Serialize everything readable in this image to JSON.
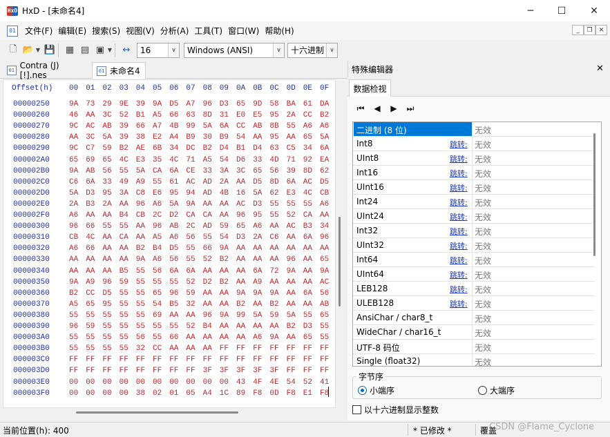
{
  "window": {
    "title": "HxD - [未命名4]",
    "logo": "HxD"
  },
  "menu": {
    "doc_icon": "01",
    "items": [
      "文件(F)",
      "编辑(E)",
      "搜索(S)",
      "视图(V)",
      "分析(A)",
      "工具(T)",
      "窗口(W)",
      "帮助(H)"
    ]
  },
  "toolbar": {
    "bytes_per_row": "16",
    "charset": "Windows (ANSI)",
    "offset_base": "十六进制"
  },
  "tabs": [
    {
      "label": "Contra (J) [!].nes",
      "active": false
    },
    {
      "label": "未命名4",
      "active": true
    }
  ],
  "hex": {
    "offset_label": "Offset(h)",
    "columns": [
      "00",
      "01",
      "02",
      "03",
      "04",
      "05",
      "06",
      "07",
      "08",
      "09",
      "0A",
      "0B",
      "0C",
      "0D",
      "0E",
      "0F"
    ],
    "rows": [
      {
        "addr": "00000250",
        "bytes": [
          "9A",
          "73",
          "29",
          "9E",
          "39",
          "9A",
          "D5",
          "A7",
          "96",
          "D3",
          "65",
          "9D",
          "58",
          "BA",
          "61",
          "DA"
        ]
      },
      {
        "addr": "00000260",
        "bytes": [
          "46",
          "AA",
          "3C",
          "52",
          "B1",
          "A5",
          "66",
          "63",
          "8D",
          "31",
          "E0",
          "E5",
          "95",
          "2A",
          "CC",
          "B2"
        ]
      },
      {
        "addr": "00000270",
        "bytes": [
          "9C",
          "AC",
          "AB",
          "39",
          "66",
          "A7",
          "4B",
          "99",
          "5A",
          "6A",
          "CC",
          "AB",
          "8B",
          "55",
          "A6",
          "A6"
        ]
      },
      {
        "addr": "00000280",
        "bytes": [
          "AA",
          "3C",
          "5A",
          "39",
          "38",
          "E2",
          "A4",
          "B9",
          "30",
          "B9",
          "54",
          "AA",
          "95",
          "AA",
          "65",
          "5A"
        ]
      },
      {
        "addr": "00000290",
        "bytes": [
          "9C",
          "C7",
          "59",
          "B2",
          "AE",
          "6B",
          "34",
          "DC",
          "B2",
          "D4",
          "B1",
          "D4",
          "63",
          "C5",
          "34",
          "6A"
        ]
      },
      {
        "addr": "000002A0",
        "bytes": [
          "65",
          "69",
          "65",
          "4C",
          "E3",
          "35",
          "4C",
          "71",
          "A5",
          "54",
          "D6",
          "33",
          "4D",
          "71",
          "92",
          "EA"
        ]
      },
      {
        "addr": "000002B0",
        "bytes": [
          "9A",
          "AB",
          "56",
          "55",
          "5A",
          "CA",
          "6A",
          "CE",
          "33",
          "3A",
          "3C",
          "65",
          "56",
          "39",
          "8D",
          "62"
        ]
      },
      {
        "addr": "000002C0",
        "bytes": [
          "C6",
          "6A",
          "33",
          "49",
          "A9",
          "55",
          "61",
          "AC",
          "AD",
          "2A",
          "AA",
          "D5",
          "8D",
          "6A",
          "AC",
          "D5"
        ]
      },
      {
        "addr": "000002D0",
        "bytes": [
          "5A",
          "D3",
          "95",
          "3A",
          "C8",
          "E6",
          "95",
          "94",
          "AD",
          "4B",
          "16",
          "5A",
          "62",
          "E3",
          "4C",
          "CB"
        ]
      },
      {
        "addr": "000002E0",
        "bytes": [
          "2A",
          "B3",
          "2A",
          "AA",
          "96",
          "A6",
          "5A",
          "9A",
          "AA",
          "AA",
          "AC",
          "D3",
          "55",
          "55",
          "55",
          "A6"
        ]
      },
      {
        "addr": "000002F0",
        "bytes": [
          "A6",
          "AA",
          "AA",
          "B4",
          "CB",
          "2C",
          "D2",
          "CA",
          "CA",
          "AA",
          "96",
          "95",
          "55",
          "52",
          "CA",
          "AA"
        ]
      },
      {
        "addr": "00000300",
        "bytes": [
          "96",
          "66",
          "55",
          "55",
          "AA",
          "96",
          "AB",
          "2C",
          "AD",
          "59",
          "65",
          "A6",
          "AA",
          "AC",
          "B3",
          "34"
        ]
      },
      {
        "addr": "00000310",
        "bytes": [
          "CB",
          "4C",
          "AA",
          "CA",
          "AA",
          "A5",
          "A6",
          "56",
          "55",
          "54",
          "D3",
          "2A",
          "C6",
          "AA",
          "6A",
          "96"
        ]
      },
      {
        "addr": "00000320",
        "bytes": [
          "A6",
          "66",
          "AA",
          "AA",
          "B2",
          "B4",
          "D5",
          "55",
          "66",
          "9A",
          "AA",
          "AA",
          "AA",
          "AA",
          "AA",
          "AA"
        ]
      },
      {
        "addr": "00000330",
        "bytes": [
          "AA",
          "AA",
          "AA",
          "AA",
          "9A",
          "A6",
          "56",
          "55",
          "52",
          "B2",
          "AA",
          "AA",
          "AA",
          "96",
          "AA",
          "65"
        ]
      },
      {
        "addr": "00000340",
        "bytes": [
          "AA",
          "AA",
          "AA",
          "B5",
          "55",
          "56",
          "6A",
          "6A",
          "AA",
          "AA",
          "AA",
          "6A",
          "72",
          "9A",
          "AA",
          "9A"
        ]
      },
      {
        "addr": "00000350",
        "bytes": [
          "9A",
          "A9",
          "96",
          "59",
          "55",
          "55",
          "55",
          "52",
          "D2",
          "B2",
          "AA",
          "A9",
          "AA",
          "AA",
          "AA",
          "AC"
        ]
      },
      {
        "addr": "00000360",
        "bytes": [
          "B2",
          "CC",
          "D5",
          "55",
          "55",
          "65",
          "96",
          "59",
          "AA",
          "AA",
          "9A",
          "9A",
          "9A",
          "AA",
          "6A",
          "56"
        ]
      },
      {
        "addr": "00000370",
        "bytes": [
          "A5",
          "65",
          "95",
          "55",
          "55",
          "54",
          "B5",
          "32",
          "AA",
          "AA",
          "B2",
          "AA",
          "B2",
          "AA",
          "AA",
          "AB"
        ]
      },
      {
        "addr": "00000380",
        "bytes": [
          "55",
          "55",
          "55",
          "55",
          "55",
          "69",
          "AA",
          "AA",
          "96",
          "9A",
          "99",
          "5A",
          "59",
          "5A",
          "55",
          "65"
        ]
      },
      {
        "addr": "00000390",
        "bytes": [
          "96",
          "59",
          "55",
          "55",
          "55",
          "55",
          "55",
          "52",
          "B4",
          "AA",
          "AA",
          "AA",
          "AA",
          "B2",
          "D3",
          "55"
        ]
      },
      {
        "addr": "000003A0",
        "bytes": [
          "55",
          "55",
          "55",
          "55",
          "56",
          "55",
          "66",
          "AA",
          "AA",
          "AA",
          "AA",
          "A6",
          "9A",
          "AA",
          "65",
          "55"
        ]
      },
      {
        "addr": "000003B0",
        "bytes": [
          "55",
          "55",
          "55",
          "55",
          "32",
          "CC",
          "AA",
          "AA",
          "AA",
          "FF",
          "FF",
          "FF",
          "FF",
          "FF",
          "FF",
          "FF"
        ]
      },
      {
        "addr": "000003C0",
        "bytes": [
          "FF",
          "FF",
          "FF",
          "FF",
          "FF",
          "FF",
          "FF",
          "FF",
          "FF",
          "FF",
          "FF",
          "FF",
          "FF",
          "FF",
          "FF",
          "FF"
        ]
      },
      {
        "addr": "000003D0",
        "bytes": [
          "FF",
          "FF",
          "FF",
          "FF",
          "FF",
          "FF",
          "FF",
          "FF",
          "3F",
          "3F",
          "3F",
          "3F",
          "3F",
          "FF",
          "FF",
          "FF"
        ]
      },
      {
        "addr": "000003E0",
        "bytes": [
          "00",
          "00",
          "00",
          "00",
          "00",
          "00",
          "00",
          "00",
          "00",
          "00",
          "43",
          "4F",
          "4E",
          "54",
          "52",
          "41"
        ]
      },
      {
        "addr": "000003F0",
        "bytes": [
          "00",
          "00",
          "00",
          "00",
          "38",
          "02",
          "01",
          "05",
          "A4",
          "1C",
          "89",
          "F8",
          "0D",
          "F8",
          "E1",
          "F8"
        ]
      }
    ]
  },
  "special_editor": {
    "title": "特殊编辑器",
    "tab": "数据检视",
    "rows": [
      {
        "name": "二进制 (8 位)",
        "link": "",
        "value": "无效",
        "selected": true
      },
      {
        "name": "Int8",
        "link": "跳转:",
        "value": "无效"
      },
      {
        "name": "UInt8",
        "link": "跳转:",
        "value": "无效"
      },
      {
        "name": "Int16",
        "link": "跳转:",
        "value": "无效"
      },
      {
        "name": "UInt16",
        "link": "跳转:",
        "value": "无效"
      },
      {
        "name": "Int24",
        "link": "跳转:",
        "value": "无效"
      },
      {
        "name": "UInt24",
        "link": "跳转:",
        "value": "无效"
      },
      {
        "name": "Int32",
        "link": "跳转:",
        "value": "无效"
      },
      {
        "name": "UInt32",
        "link": "跳转:",
        "value": "无效"
      },
      {
        "name": "Int64",
        "link": "跳转:",
        "value": "无效"
      },
      {
        "name": "UInt64",
        "link": "跳转:",
        "value": "无效"
      },
      {
        "name": "LEB128",
        "link": "跳转:",
        "value": "无效"
      },
      {
        "name": "ULEB128",
        "link": "跳转:",
        "value": "无效"
      },
      {
        "name": "AnsiChar / char8_t",
        "link": "",
        "value": "无效"
      },
      {
        "name": "WideChar / char16_t",
        "link": "",
        "value": "无效"
      },
      {
        "name": "UTF-8 码位",
        "link": "",
        "value": "无效"
      },
      {
        "name": "Single (float32)",
        "link": "",
        "value": "无效"
      }
    ],
    "byte_order": {
      "title": "字节序",
      "little": "小端序",
      "big": "大端序",
      "selected": "little"
    },
    "hex_int_label": "以十六进制显示整数"
  },
  "status": {
    "position": "当前位置(h): 400",
    "modified": "* 已修改 *",
    "mode": "覆盖"
  },
  "watermark": "CSDN @Flame_Cyclone",
  "colors": {
    "address": "#1f2fa8",
    "byte": "#c0282c",
    "selection": "#0078d7",
    "link": "#1a37c8"
  }
}
